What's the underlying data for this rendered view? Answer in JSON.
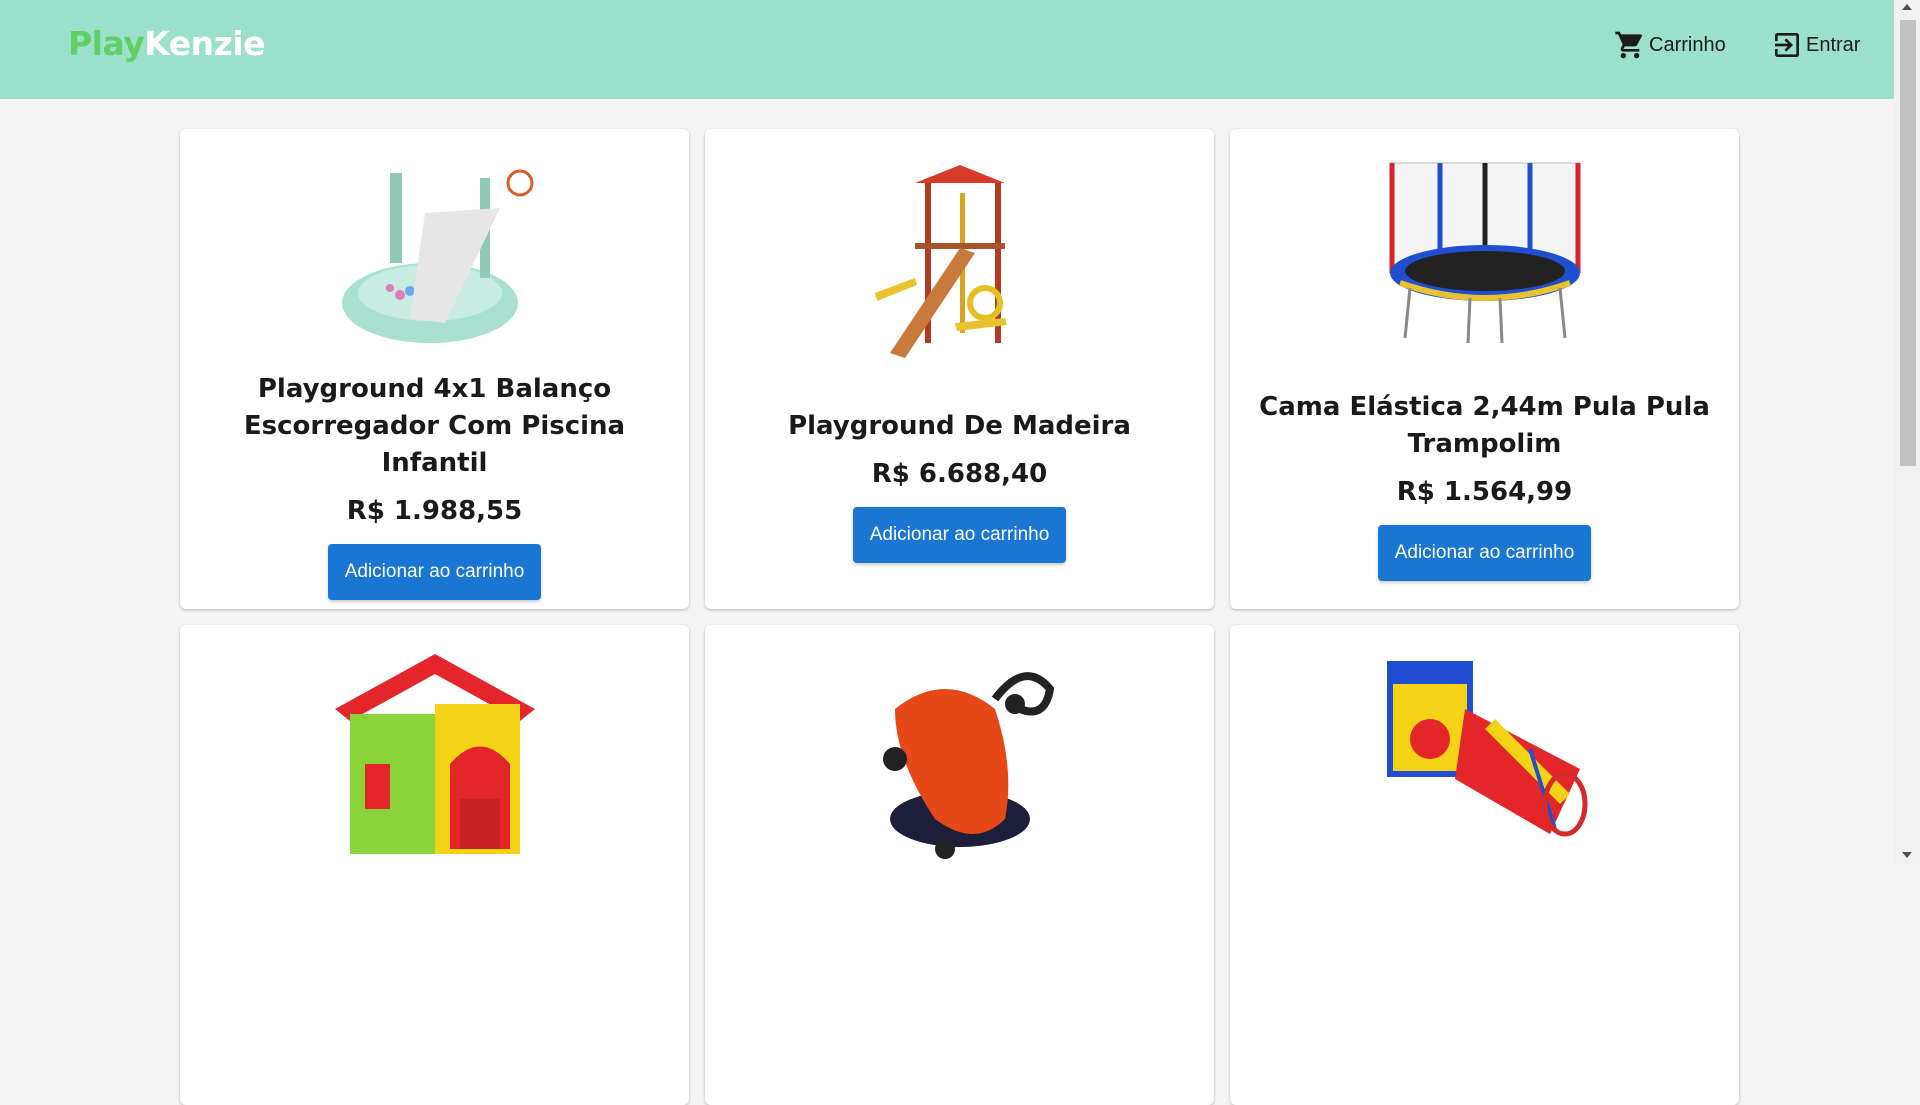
{
  "header": {
    "logo_play": "Play",
    "logo_kenzie": "Kenzie",
    "cart_label": "Carrinho",
    "login_label": "Entrar",
    "cart_icon": "cart-icon",
    "login_icon": "login-icon"
  },
  "colors": {
    "header_bg": "#9be0cb",
    "logo_green": "#5fcf66",
    "button_blue": "#1976d2"
  },
  "products": [
    {
      "name": "Playground 4x1 Balanço Escorregador Com Piscina Infantil",
      "price": "R$ 1.988,55",
      "button": "Adicionar ao carrinho",
      "image": "playground-slide-pool-image"
    },
    {
      "name": "Playground De Madeira",
      "price": "R$ 6.688,40",
      "button": "Adicionar ao carrinho",
      "image": "wooden-playground-image"
    },
    {
      "name": "Cama Elástica 2,44m Pula Pula Trampolim",
      "price": "R$ 1.564,99",
      "button": "Adicionar ao carrinho",
      "image": "trampoline-image"
    },
    {
      "image": "playhouse-image"
    },
    {
      "image": "ride-on-car-image"
    },
    {
      "image": "play-tunnel-image"
    }
  ]
}
